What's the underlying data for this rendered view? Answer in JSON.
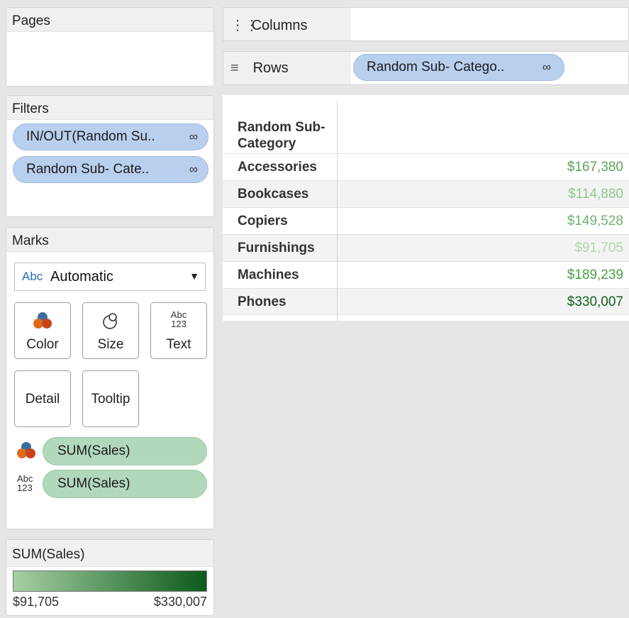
{
  "pages": {
    "title": "Pages"
  },
  "columns_shelf": {
    "label": "Columns"
  },
  "rows_shelf": {
    "label": "Rows",
    "pill": "Random Sub- Catego.."
  },
  "filters": {
    "title": "Filters",
    "pills": [
      "IN/OUT(Random Su..",
      "Random Sub- Cate.."
    ]
  },
  "marks": {
    "title": "Marks",
    "mark_type_icon": "Abc",
    "mark_type": "Automatic",
    "cards": {
      "color": "Color",
      "size": "Size",
      "text": "Text",
      "text_icon_top": "Abc",
      "text_icon_bottom": "123",
      "detail": "Detail",
      "tooltip": "Tooltip"
    },
    "fields": [
      {
        "label": "SUM(Sales)",
        "icon": "color-icon"
      },
      {
        "label": "SUM(Sales)",
        "icon": "text-icon",
        "icon_top": "Abc",
        "icon_bottom": "123"
      }
    ]
  },
  "legend": {
    "title": "SUM(Sales)",
    "min_label": "$91,705",
    "max_label": "$330,007",
    "color_low": "#a6cfa3",
    "color_high": "#0c5a1c"
  },
  "table": {
    "header": "Random Sub- Category",
    "header_line1": "Random Sub-",
    "header_line2": "Category",
    "rows": [
      {
        "label": "Accessories",
        "value": "$167,380",
        "color": "#5aa657"
      },
      {
        "label": "Bookcases",
        "value": "$114,880",
        "color": "#8fc68b"
      },
      {
        "label": "Copiers",
        "value": "$149,528",
        "color": "#6fb26b"
      },
      {
        "label": "Furnishings",
        "value": "$91,705",
        "color": "#b3d6ae"
      },
      {
        "label": "Machines",
        "value": "$189,239",
        "color": "#4a9e47"
      },
      {
        "label": "Phones",
        "value": "$330,007",
        "color": "#145f22"
      }
    ]
  }
}
